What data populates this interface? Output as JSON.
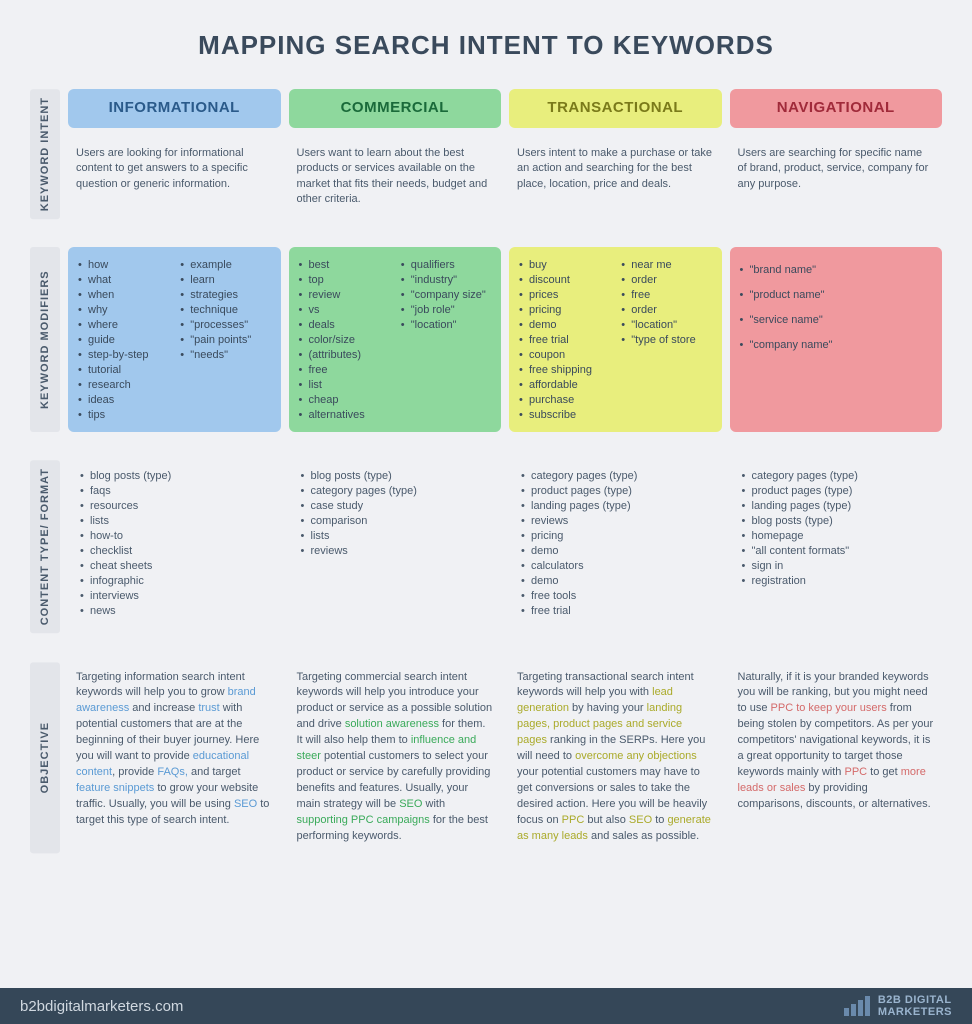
{
  "title": "MAPPING SEARCH INTENT TO KEYWORDS",
  "rowlabels": {
    "intent": "KEYWORD INTENT",
    "modifiers": "KEYWORD MODIFIERS",
    "format": "CONTENT TYPE/ FORMAT",
    "objective": "OBJECTIVE"
  },
  "cols": [
    {
      "header": "INFORMATIONAL",
      "desc": "Users are looking for informational content to get answers to a specific question or generic information.",
      "mods_a": [
        "how",
        "what",
        "when",
        "why",
        "where",
        "guide",
        "step-by-step",
        "tutorial",
        "research",
        "ideas",
        "tips"
      ],
      "mods_b": [
        "example",
        "learn",
        "strategies",
        "technique",
        "\"processes\"",
        "\"pain points\"",
        "\"needs\""
      ],
      "fmt": [
        "blog posts (type)",
        "faqs",
        "resources",
        "lists",
        "how-to",
        "checklist",
        "cheat sheets",
        "infographic",
        "interviews",
        "news"
      ]
    },
    {
      "header": "COMMERCIAL",
      "desc": "Users want to learn about the best products or services available on the market that fits their needs, budget and other criteria.",
      "mods_a": [
        "best",
        "top",
        "review",
        "vs",
        "deals",
        "color/size",
        "(attributes)",
        "free",
        "list",
        "cheap",
        "alternatives"
      ],
      "mods_b": [
        "qualifiers",
        "\"industry\"",
        "\"company size\"",
        "\"job role\"",
        "\"location\""
      ],
      "fmt": [
        "blog posts (type)",
        "category pages (type)",
        "case study",
        "comparison",
        "lists",
        "reviews"
      ]
    },
    {
      "header": "TRANSACTIONAL",
      "desc": "Users intent to make a purchase or take an action and searching for the best place, location, price and deals.",
      "mods_a": [
        "buy",
        "discount",
        "prices",
        "pricing",
        "demo",
        "free trial",
        "coupon",
        "free shipping",
        "affordable",
        "purchase",
        "subscribe"
      ],
      "mods_b": [
        "near me",
        "order",
        "free",
        "order",
        "\"location\"",
        "\"type of store"
      ],
      "fmt": [
        "category pages (type)",
        "product pages (type)",
        "landing pages (type)",
        "reviews",
        "pricing",
        "demo",
        "calculators",
        "demo",
        "free tools",
        "free trial"
      ]
    },
    {
      "header": "NAVIGATIONAL",
      "desc": "Users are searching for specific name of brand, product, service, company for any purpose.",
      "mods_a": [
        "\"brand name\"",
        "\"product name\"",
        "\"service name\"",
        "\"company name\""
      ],
      "fmt": [
        "category pages (type)",
        "product pages (type)",
        "landing pages (type)",
        "blog posts (type)",
        "homepage",
        "\"all content formats\"",
        "sign in",
        "registration"
      ]
    }
  ],
  "objectives": {
    "c1": {
      "pre": "Targeting information search intent keywords will help you to grow ",
      "h1": "brand awareness",
      "t1": " and increase ",
      "h2": "trust",
      "t2": " with potential customers that are at the beginning of their buyer journey. Here you will want to provide ",
      "h3": "educational content",
      "t3": ", provide ",
      "h4": "FAQs,",
      "t4": " and target ",
      "h5": "feature snippets",
      "t5": " to grow your website traffic. Usually, you will be using ",
      "h6": "SEO",
      "t6": " to target this type of search intent."
    },
    "c2": {
      "pre": "Targeting commercial search intent keywords will help you introduce your product or service as a possible solution and drive ",
      "h1": "solution awareness",
      "t1": " for them. It will also help them to ",
      "h2": "influence and steer",
      "t2": " potential customers to select your product or service by carefully providing benefits and features. Usually, your main strategy will be ",
      "h3": "SEO",
      "t3": " with ",
      "h4": "supporting PPC campaigns",
      "t4": " for the best performing keywords."
    },
    "c3": {
      "pre": "Targeting transactional search intent keywords will help you with ",
      "h1": "lead generation",
      "t1": " by having your ",
      "h2": "landing pages, product pages and service pages",
      "t2": " ranking in the SERPs. Here you will need to ",
      "h3": "overcome any objections",
      "t3": " your potential customers may have to get conversions or sales to take the desired action. Here you will be heavily focus on ",
      "h4": "PPC",
      "t4": " but also ",
      "h5": "SEO",
      "t5": " to ",
      "h6": "generate as many leads",
      "t6": " and sales as possible."
    },
    "c4": {
      "pre": "Naturally, if it is your branded keywords you will be ranking, but you might need to use ",
      "h1": "PPC to keep your users",
      "t1": " from being stolen by competitors. As per your competitors' navigational keywords, it is a great opportunity to target those keywords mainly with ",
      "h2": "PPC",
      "t2": " to get ",
      "h3": "more leads or sales",
      "t3": " by providing comparisons, discounts, or alternatives."
    }
  },
  "footer": {
    "url": "b2bdigitalmarketers.com",
    "brand_top": "B2B DIGITAL",
    "brand_bot": "MARKETERS"
  }
}
